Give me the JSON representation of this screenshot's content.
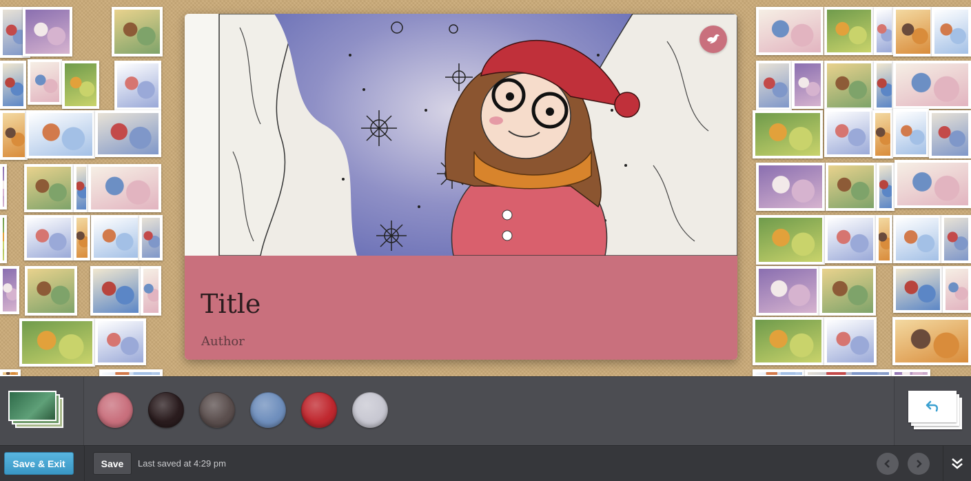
{
  "card": {
    "title": "Title",
    "author": "Author",
    "meta_color": "#c9707d"
  },
  "palette": {
    "swatches": [
      "#c9707d",
      "#2a1c1e",
      "#5b4f4e",
      "#6f8fbd",
      "#c0282f",
      "#c8c8d2"
    ]
  },
  "footer": {
    "save_exit_label": "Save & Exit",
    "save_label": "Save",
    "last_saved": "Last saved at 4:29 pm"
  },
  "icons": {
    "share": "bird-icon",
    "undo": "undo-arrow-icon",
    "prev": "chevron-left-icon",
    "next": "chevron-right-icon",
    "collapse": "double-chevron-down-icon"
  }
}
